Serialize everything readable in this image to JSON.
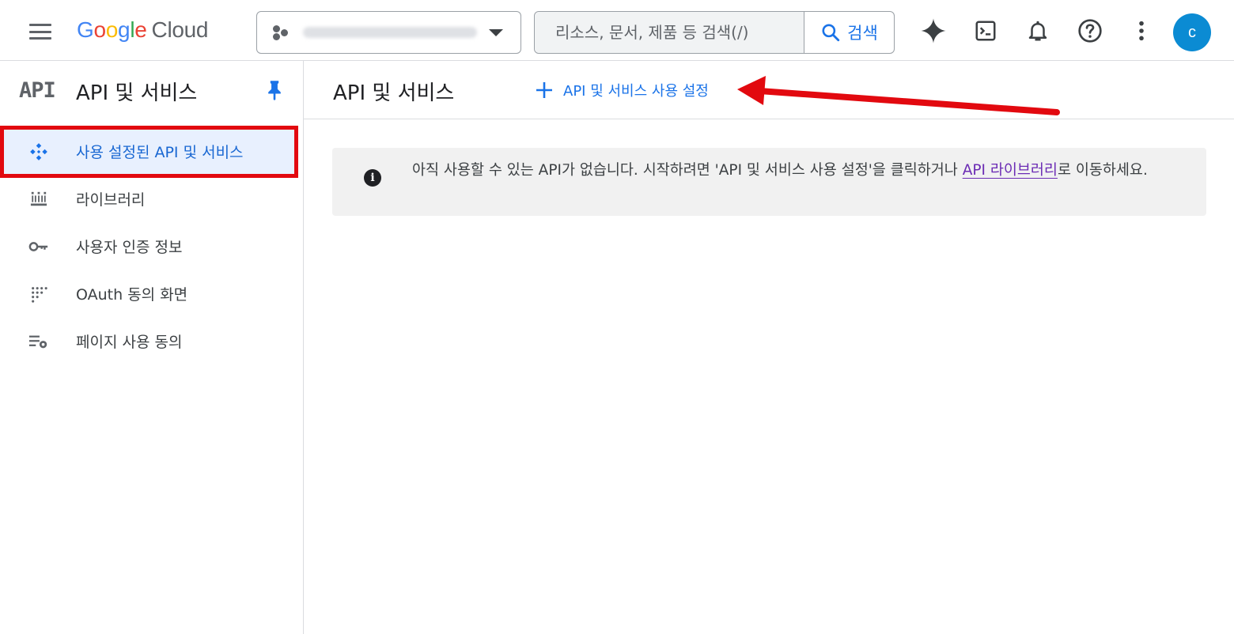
{
  "header": {
    "logo": {
      "google": [
        "G",
        "o",
        "o",
        "g",
        "l",
        "e"
      ],
      "cloud": "Cloud"
    },
    "search": {
      "placeholder": "리소스, 문서, 제품 등 검색(/)",
      "button_label": "검색"
    },
    "avatar_letter": "c"
  },
  "sidebar": {
    "glyph": "API",
    "title": "API 및 서비스",
    "items": [
      {
        "label": "사용 설정된 API 및 서비스",
        "icon": "api-diamond-icon",
        "active": true
      },
      {
        "label": "라이브러리",
        "icon": "library-icon",
        "active": false
      },
      {
        "label": "사용자 인증 정보",
        "icon": "key-icon",
        "active": false
      },
      {
        "label": "OAuth 동의 화면",
        "icon": "oauth-dots-icon",
        "active": false
      },
      {
        "label": "페이지 사용 동의",
        "icon": "settings-list-icon",
        "active": false
      }
    ]
  },
  "main": {
    "title": "API 및 서비스",
    "enable_button": "API 및 서비스 사용 설정",
    "info": {
      "text_before": "아직 사용할 수 있는 API가 없습니다. 시작하려면 'API 및 서비스 사용 설정'을 클릭하거나 ",
      "link": "API 라이브러리",
      "text_after": "로 이동하세요."
    }
  },
  "colors": {
    "accent": "#1a73e8",
    "annotation_red": "#e2090f",
    "avatar_bg": "#0b8bd3",
    "link": "#6b2bb4"
  }
}
